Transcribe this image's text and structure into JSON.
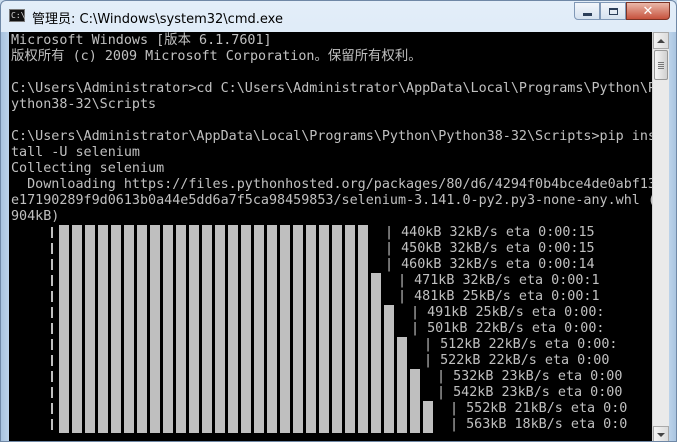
{
  "window": {
    "title": "管理员: C:\\Windows\\system32\\cmd.exe",
    "icon": "cmd-icon",
    "icon_label": "C:\\",
    "buttons": {
      "minimize": "minimize-icon",
      "maximize": "maximize-icon",
      "close": "close-icon"
    },
    "close_glyph": "✕"
  },
  "console": {
    "lines": [
      "Microsoft Windows [版本 6.1.7601]",
      "版权所有 (c) 2009 Microsoft Corporation。保留所有权利。",
      "",
      "C:\\Users\\Administrator>cd C:\\Users\\Administrator\\AppData\\Local\\Programs\\Python\\P",
      "ython38-32\\Scripts",
      "",
      "C:\\Users\\Administrator\\AppData\\Local\\Programs\\Python\\Python38-32\\Scripts>pip ins",
      "tall -U selenium",
      "Collecting selenium",
      "  Downloading https://files.pythonhosted.org/packages/80/d6/4294f0b4bce4de0abf13",
      "e17190289f9d0613b0a44e5dd6a7f5ca98459853/selenium-3.141.0-py2.py3-none-any.whl (",
      "904kB)"
    ],
    "progress_rows": [
      {
        "blocks": 24,
        "stats": "| 440kB 32kB/s eta 0:00:15"
      },
      {
        "blocks": 24,
        "stats": "| 450kB 32kB/s eta 0:00:15"
      },
      {
        "blocks": 24,
        "stats": "| 460kB 32kB/s eta 0:00:14"
      },
      {
        "blocks": 25,
        "stats": "| 471kB 32kB/s eta 0:00:1"
      },
      {
        "blocks": 25,
        "stats": "| 481kB 25kB/s eta 0:00:1"
      },
      {
        "blocks": 26,
        "stats": "| 491kB 25kB/s eta 0:00:"
      },
      {
        "blocks": 26,
        "stats": "| 501kB 22kB/s eta 0:00:"
      },
      {
        "blocks": 27,
        "stats": "| 512kB 22kB/s eta 0:00:"
      },
      {
        "blocks": 27,
        "stats": "| 522kB 22kB/s eta 0:00"
      },
      {
        "blocks": 28,
        "stats": "| 532kB 23kB/s eta 0:00"
      },
      {
        "blocks": 28,
        "stats": "| 542kB 23kB/s eta 0:00"
      },
      {
        "blocks": 29,
        "stats": "| 552kB 21kB/s eta 0:0"
      },
      {
        "blocks": 29,
        "stats": "| 563kB 18kB/s eta 0:0"
      }
    ]
  },
  "scrollbar": {
    "up": "scroll-up-arrow-icon",
    "down": "scroll-down-arrow-icon",
    "position": 0.0
  },
  "colors": {
    "console_bg": "#000000",
    "console_fg": "#c0c0c0",
    "progress_block": "#bfbfbf"
  }
}
